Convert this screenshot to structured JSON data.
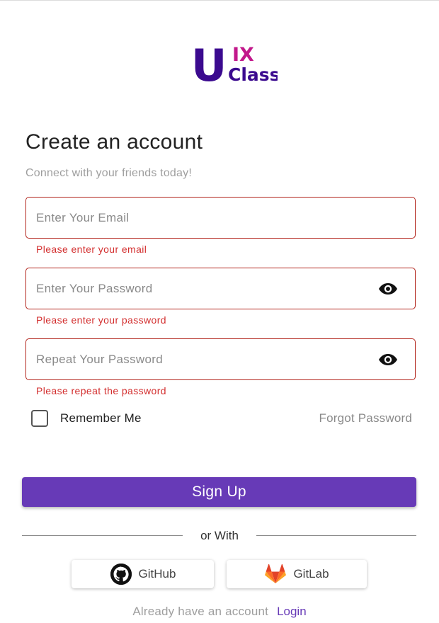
{
  "logo": {
    "letter": "U",
    "text_top": "IX",
    "text_bottom": "Class"
  },
  "header": {
    "title": "Create an account",
    "subtitle": "Connect with your friends today!"
  },
  "form": {
    "email": {
      "placeholder": "Enter Your Email",
      "value": "",
      "error": "Please enter your email"
    },
    "password": {
      "placeholder": "Enter Your Password",
      "value": "",
      "error": "Please enter your password",
      "toggle_icon": "eye-icon"
    },
    "repeat_password": {
      "placeholder": "Repeat Your Password",
      "value": "",
      "error": "Please repeat the password",
      "toggle_icon": "eye-icon"
    },
    "remember_label": "Remember Me",
    "remember_checked": false,
    "forgot_label": "Forgot Password",
    "submit_label": "Sign Up"
  },
  "divider": {
    "label": "or With"
  },
  "social": {
    "github_label": "GitHub",
    "gitlab_label": "GitLab"
  },
  "footer": {
    "prompt": "Already have an account",
    "login_label": "Login"
  },
  "colors": {
    "primary": "#673ab7",
    "error": "#d32f2f",
    "field_border_error": "#b3261e",
    "logo_u": "#3b0a8f",
    "logo_text_top": "#c2188b"
  }
}
